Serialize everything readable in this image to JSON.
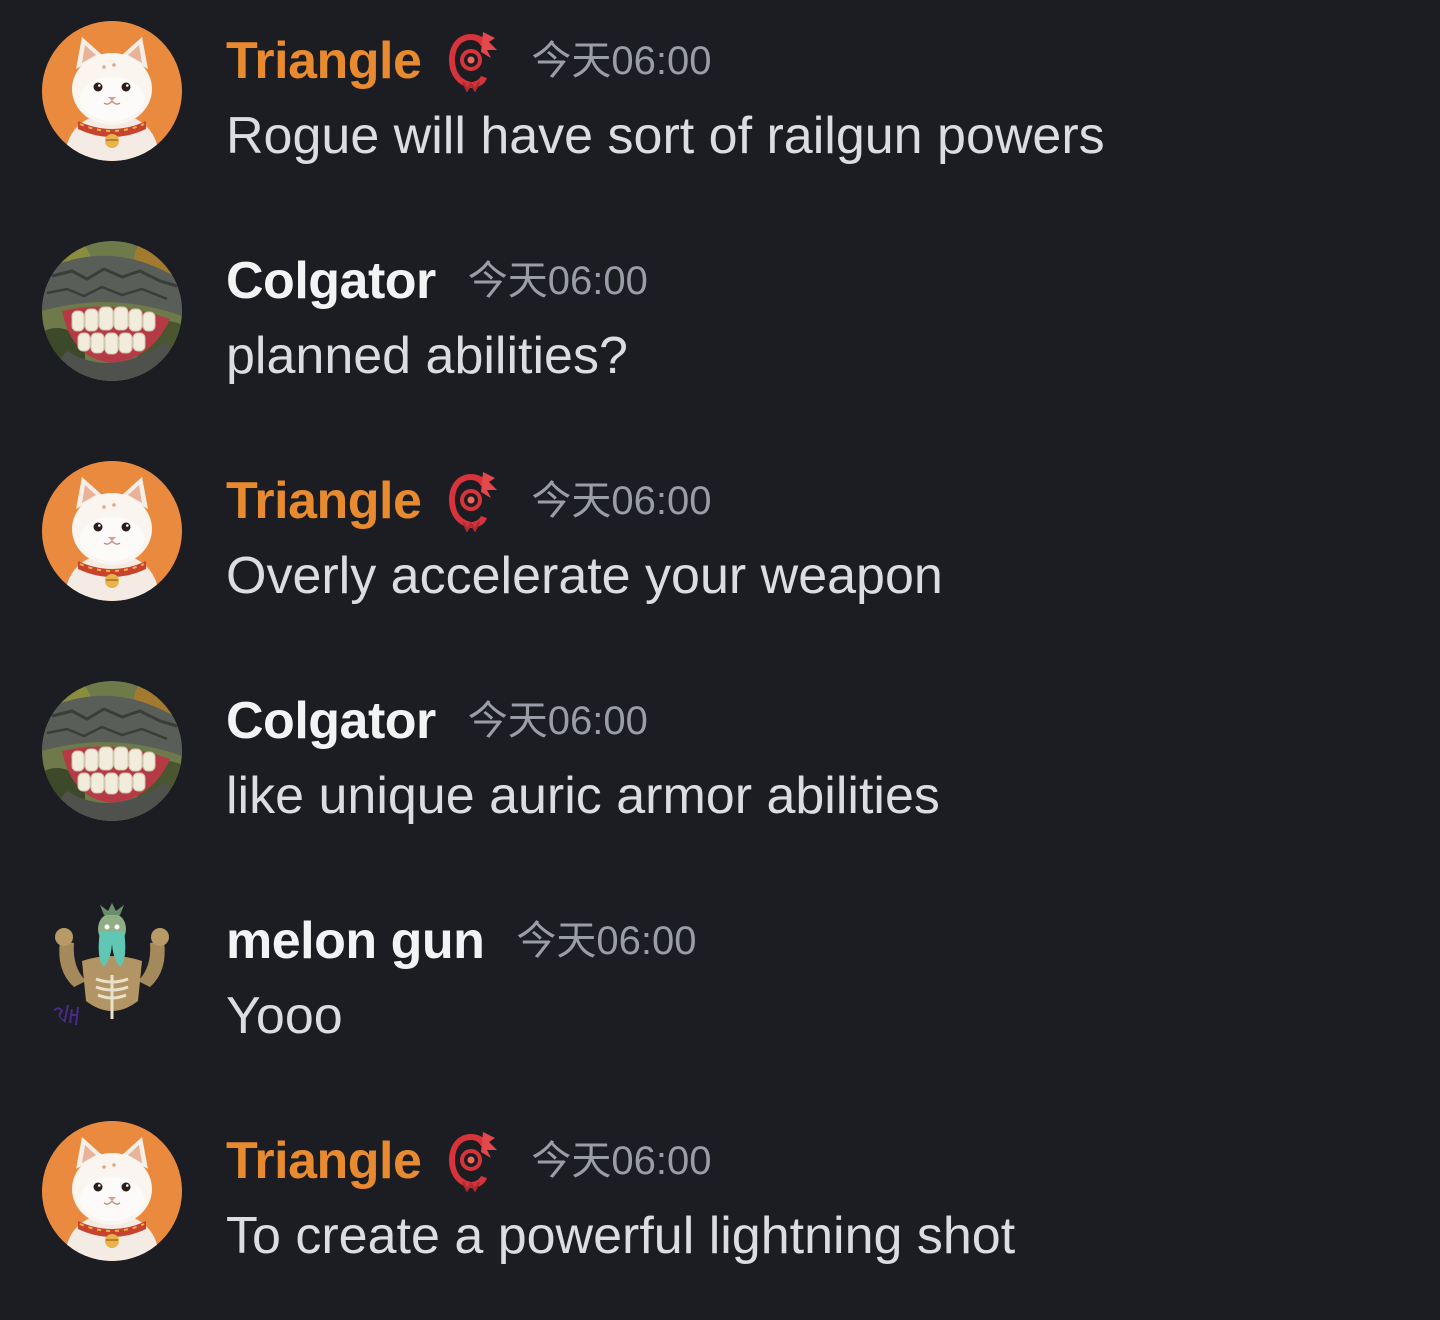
{
  "colors": {
    "background": "#1c1d22",
    "triangle_name": "#e88a2f",
    "default_name": "#f2f3f5",
    "message_text": "#dcdde2",
    "timestamp": "#9a9ca6"
  },
  "messages": [
    {
      "author": "Triangle",
      "author_color": "#e88a2f",
      "avatar": "cat-avatar",
      "role_icon": "red-role-emblem-icon",
      "timestamp": "今天06:00",
      "text": "Rogue will have sort of railgun powers"
    },
    {
      "author": "Colgator",
      "author_color": "#f2f3f5",
      "avatar": "alligator-teeth-avatar",
      "role_icon": null,
      "timestamp": "今天06:00",
      "text": "planned abilities?"
    },
    {
      "author": "Triangle",
      "author_color": "#e88a2f",
      "avatar": "cat-avatar",
      "role_icon": "red-role-emblem-icon",
      "timestamp": "今天06:00",
      "text": "Overly accelerate your weapon"
    },
    {
      "author": "Colgator",
      "author_color": "#f2f3f5",
      "avatar": "alligator-teeth-avatar",
      "role_icon": null,
      "timestamp": "今天06:00",
      "text": "like unique auric armor abilities"
    },
    {
      "author": "melon gun",
      "author_color": "#f2f3f5",
      "avatar": "muscular-creature-avatar",
      "role_icon": null,
      "timestamp": "今天06:00",
      "text": "Yooo"
    },
    {
      "author": "Triangle",
      "author_color": "#e88a2f",
      "avatar": "cat-avatar",
      "role_icon": "red-role-emblem-icon",
      "timestamp": "今天06:00",
      "text": "To create a powerful lightning shot"
    }
  ]
}
